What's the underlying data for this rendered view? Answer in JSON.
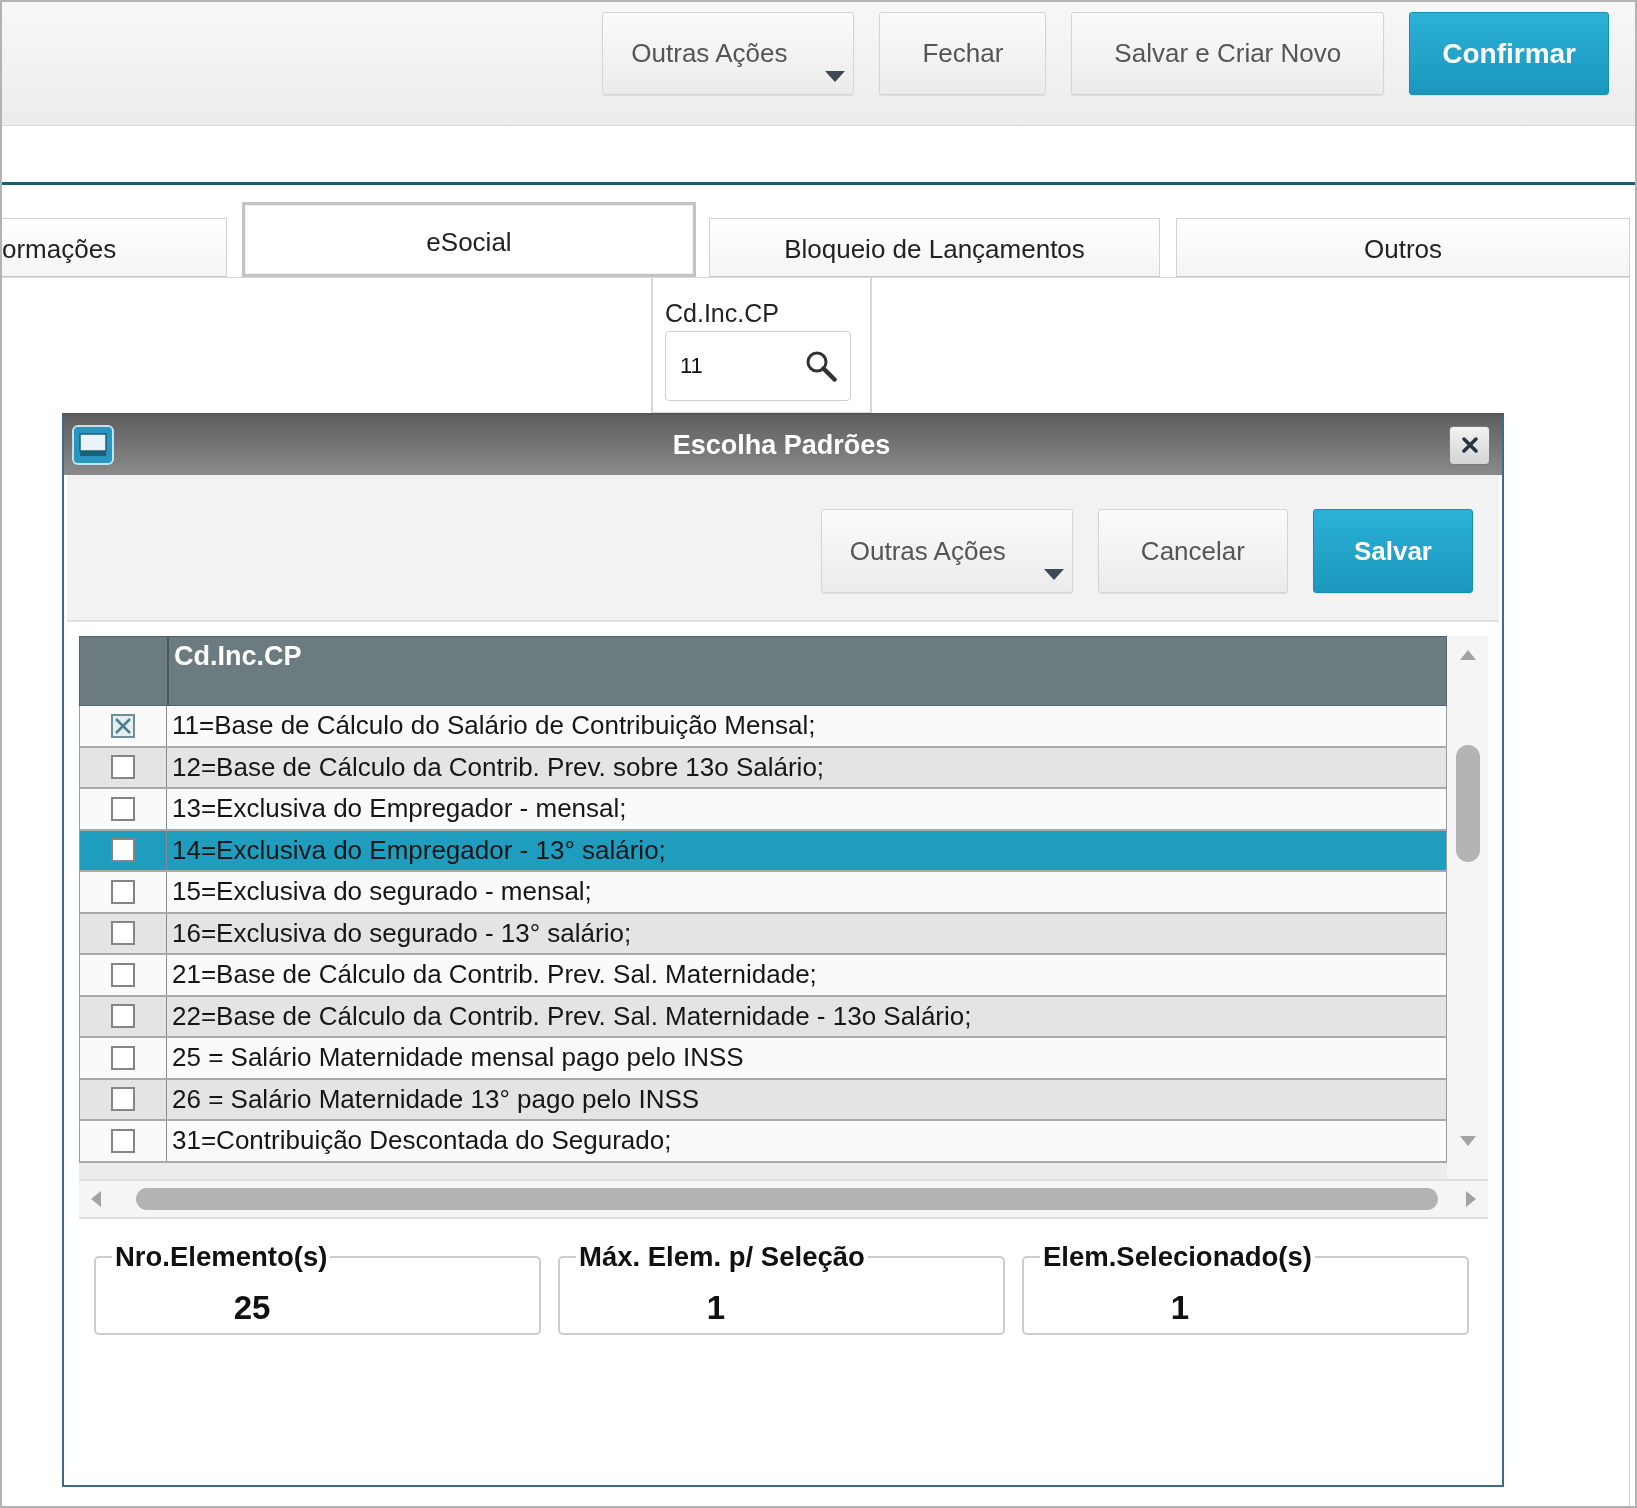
{
  "toolbar": {
    "buttons": [
      {
        "label": "Outras Ações",
        "kind": "menu"
      },
      {
        "label": "Fechar",
        "kind": "plain"
      },
      {
        "label": "Salvar e Criar Novo",
        "kind": "plain"
      },
      {
        "label": "Confirmar",
        "kind": "primary"
      }
    ]
  },
  "tabs": [
    {
      "label": "ormações",
      "selected": false
    },
    {
      "label": "eSocial",
      "selected": true
    },
    {
      "label": "Bloqueio de Lançamentos",
      "selected": false
    },
    {
      "label": "Outros",
      "selected": false
    }
  ],
  "field": {
    "label": "Cd.Inc.CP",
    "value": "11"
  },
  "dialog": {
    "title": "Escolha Padrões",
    "buttons": [
      {
        "label": "Outras Ações",
        "kind": "menu"
      },
      {
        "label": "Cancelar",
        "kind": "plain"
      },
      {
        "label": "Salvar",
        "kind": "primary"
      }
    ],
    "table": {
      "columns": [
        {
          "label": "Cd.Inc.CP"
        }
      ],
      "rows": [
        {
          "text": "11=Base de Cálculo do Salário de Contribuição Mensal;",
          "checked": true,
          "selected": false
        },
        {
          "text": "12=Base de Cálculo da Contrib. Prev. sobre 13o Salário;",
          "checked": false,
          "selected": false
        },
        {
          "text": "13=Exclusiva do Empregador - mensal;",
          "checked": false,
          "selected": false
        },
        {
          "text": "14=Exclusiva do Empregador - 13° salário;",
          "checked": false,
          "selected": true
        },
        {
          "text": "15=Exclusiva do segurado - mensal;",
          "checked": false,
          "selected": false
        },
        {
          "text": "16=Exclusiva do segurado - 13° salário;",
          "checked": false,
          "selected": false
        },
        {
          "text": "21=Base de Cálculo da Contrib. Prev. Sal. Maternidade;",
          "checked": false,
          "selected": false
        },
        {
          "text": "22=Base de Cálculo da Contrib. Prev. Sal. Maternidade - 13o Salário;",
          "checked": false,
          "selected": false
        },
        {
          "text": "25 = Salário Maternidade mensal pago pelo INSS",
          "checked": false,
          "selected": false
        },
        {
          "text": "26 = Salário Maternidade 13° pago pelo INSS",
          "checked": false,
          "selected": false
        },
        {
          "text": "31=Contribuição Descontada do Segurado;",
          "checked": false,
          "selected": false
        }
      ]
    },
    "counters": [
      {
        "label": "Nro.Elemento(s)",
        "value": "25"
      },
      {
        "label": "Máx. Elem. p/ Seleção",
        "value": "1"
      },
      {
        "label": "Elem.Selecionado(s)",
        "value": "1"
      }
    ]
  }
}
